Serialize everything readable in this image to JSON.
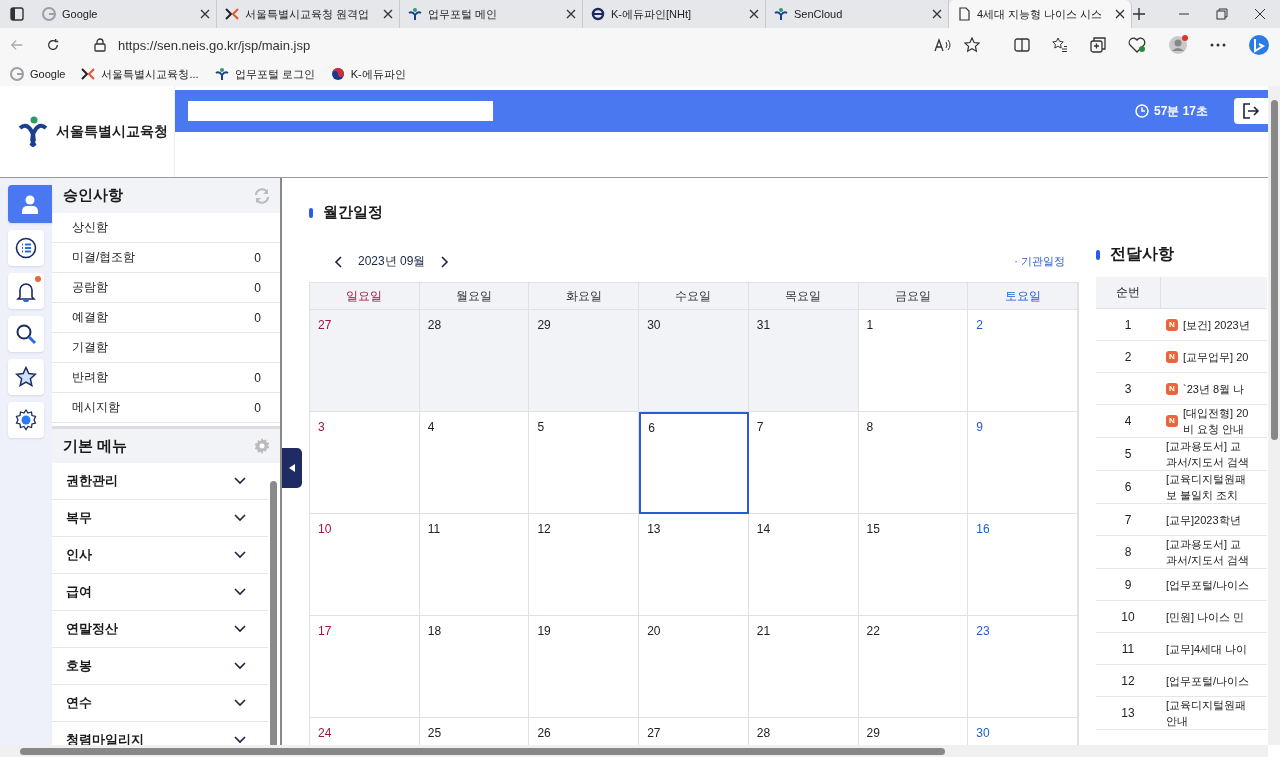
{
  "browser": {
    "tabs": [
      {
        "title": "Google",
        "selected": false
      },
      {
        "title": "서울특별시교육청 원격업",
        "selected": false
      },
      {
        "title": "업무포털 메인",
        "selected": false
      },
      {
        "title": "K-에듀파인[NHt]",
        "selected": false
      },
      {
        "title": "SenCloud",
        "selected": false
      },
      {
        "title": "4세대 지능형 나이스 시스",
        "selected": true
      }
    ],
    "url": "https://sen.neis.go.kr/jsp/main.jsp",
    "bookmarks": [
      {
        "title": "Google"
      },
      {
        "title": "서울특별시교육청..."
      },
      {
        "title": "업무포털 로그인"
      },
      {
        "title": "K-에듀파인"
      }
    ]
  },
  "header": {
    "org_name": "서울특별시교육청",
    "session_timer": "57분 17초"
  },
  "side_icons": [
    {
      "kind": "person",
      "selected": true,
      "alert": false
    },
    {
      "kind": "list",
      "selected": false,
      "alert": false
    },
    {
      "kind": "bell",
      "selected": false,
      "alert": true
    },
    {
      "kind": "search",
      "selected": false,
      "alert": false
    },
    {
      "kind": "star",
      "selected": false,
      "alert": false
    },
    {
      "kind": "gear",
      "selected": false,
      "alert": false
    }
  ],
  "approvals": {
    "title": "승인사항",
    "items": [
      {
        "label": "상신함"
      },
      {
        "label": "미결/협조함",
        "count": "0"
      },
      {
        "label": "공람함",
        "count": "0"
      },
      {
        "label": "예결함",
        "count": "0"
      },
      {
        "label": "기결함"
      },
      {
        "label": "반려함",
        "count": "0"
      },
      {
        "label": "메시지함",
        "count": "0"
      }
    ]
  },
  "basic_menu": {
    "title": "기본 메뉴",
    "items": [
      {
        "label": "권한관리",
        "expanded": false
      },
      {
        "label": "복무",
        "expanded": false
      },
      {
        "label": "인사",
        "expanded": false
      },
      {
        "label": "급여",
        "expanded": false
      },
      {
        "label": "연말정산",
        "expanded": false
      },
      {
        "label": "호봉",
        "expanded": false
      },
      {
        "label": "연수",
        "expanded": false
      },
      {
        "label": "청렴마일리지",
        "expanded": false
      }
    ]
  },
  "calendar": {
    "title": "월간일정",
    "month": "2023년 09월",
    "filter_link": "· 기관일정",
    "weekdays": [
      "일요일",
      "월요일",
      "화요일",
      "수요일",
      "목요일",
      "금요일",
      "토요일"
    ],
    "weeks": [
      [
        {
          "day": "27",
          "other_month": true,
          "today": false
        },
        {
          "day": "28",
          "other_month": true,
          "today": false
        },
        {
          "day": "29",
          "other_month": true,
          "today": false
        },
        {
          "day": "30",
          "other_month": true,
          "today": false
        },
        {
          "day": "31",
          "other_month": true,
          "today": false
        },
        {
          "day": "1",
          "other_month": false,
          "today": false
        },
        {
          "day": "2",
          "other_month": false,
          "today": false
        }
      ],
      [
        {
          "day": "3",
          "other_month": false,
          "today": false
        },
        {
          "day": "4",
          "other_month": false,
          "today": false
        },
        {
          "day": "5",
          "other_month": false,
          "today": false
        },
        {
          "day": "6",
          "other_month": false,
          "today": true
        },
        {
          "day": "7",
          "other_month": false,
          "today": false
        },
        {
          "day": "8",
          "other_month": false,
          "today": false
        },
        {
          "day": "9",
          "other_month": false,
          "today": false
        }
      ],
      [
        {
          "day": "10",
          "other_month": false,
          "today": false
        },
        {
          "day": "11",
          "other_month": false,
          "today": false
        },
        {
          "day": "12",
          "other_month": false,
          "today": false
        },
        {
          "day": "13",
          "other_month": false,
          "today": false
        },
        {
          "day": "14",
          "other_month": false,
          "today": false
        },
        {
          "day": "15",
          "other_month": false,
          "today": false
        },
        {
          "day": "16",
          "other_month": false,
          "today": false
        }
      ],
      [
        {
          "day": "17",
          "other_month": false,
          "today": false
        },
        {
          "day": "18",
          "other_month": false,
          "today": false
        },
        {
          "day": "19",
          "other_month": false,
          "today": false
        },
        {
          "day": "20",
          "other_month": false,
          "today": false
        },
        {
          "day": "21",
          "other_month": false,
          "today": false
        },
        {
          "day": "22",
          "other_month": false,
          "today": false
        },
        {
          "day": "23",
          "other_month": false,
          "today": false
        }
      ],
      [
        {
          "day": "24",
          "other_month": false,
          "today": false
        },
        {
          "day": "25",
          "other_month": false,
          "today": false
        },
        {
          "day": "26",
          "other_month": false,
          "today": false
        },
        {
          "day": "27",
          "other_month": false,
          "today": false
        },
        {
          "day": "28",
          "other_month": false,
          "today": false
        },
        {
          "day": "29",
          "other_month": false,
          "today": false
        },
        {
          "day": "30",
          "other_month": false,
          "today": false
        }
      ]
    ]
  },
  "notices": {
    "title": "전달사항",
    "columns": [
      "순번"
    ],
    "rows": [
      {
        "no": "1",
        "badge": "N",
        "lines": [
          "[보건] 2023년"
        ]
      },
      {
        "no": "2",
        "badge": "N",
        "lines": [
          "[교무업무] 20"
        ]
      },
      {
        "no": "3",
        "badge": "N",
        "lines": [
          "`23년 8월 나"
        ]
      },
      {
        "no": "4",
        "badge": "N",
        "lines": [
          "[대입전형] 20",
          "비 요청 안내"
        ]
      },
      {
        "no": "5",
        "lines": [
          "[교과용도서] 교",
          "과서/지도서 검색"
        ]
      },
      {
        "no": "6",
        "lines": [
          "[교육디지털원패",
          "보 불일치 조치"
        ]
      },
      {
        "no": "7",
        "lines": [
          "[교무]2023학년"
        ]
      },
      {
        "no": "8",
        "lines": [
          "[교과용도서] 교",
          "과서/지도서 검색"
        ]
      },
      {
        "no": "9",
        "lines": [
          "[업무포털/나이스"
        ]
      },
      {
        "no": "10",
        "lines": [
          "[민원] 나이스 민"
        ]
      },
      {
        "no": "11",
        "lines": [
          "[교무]4세대 나이"
        ]
      },
      {
        "no": "12",
        "lines": [
          "[업무포털/나이스"
        ]
      },
      {
        "no": "13",
        "lines": [
          "[교육디지털원패",
          "안내"
        ]
      }
    ]
  }
}
